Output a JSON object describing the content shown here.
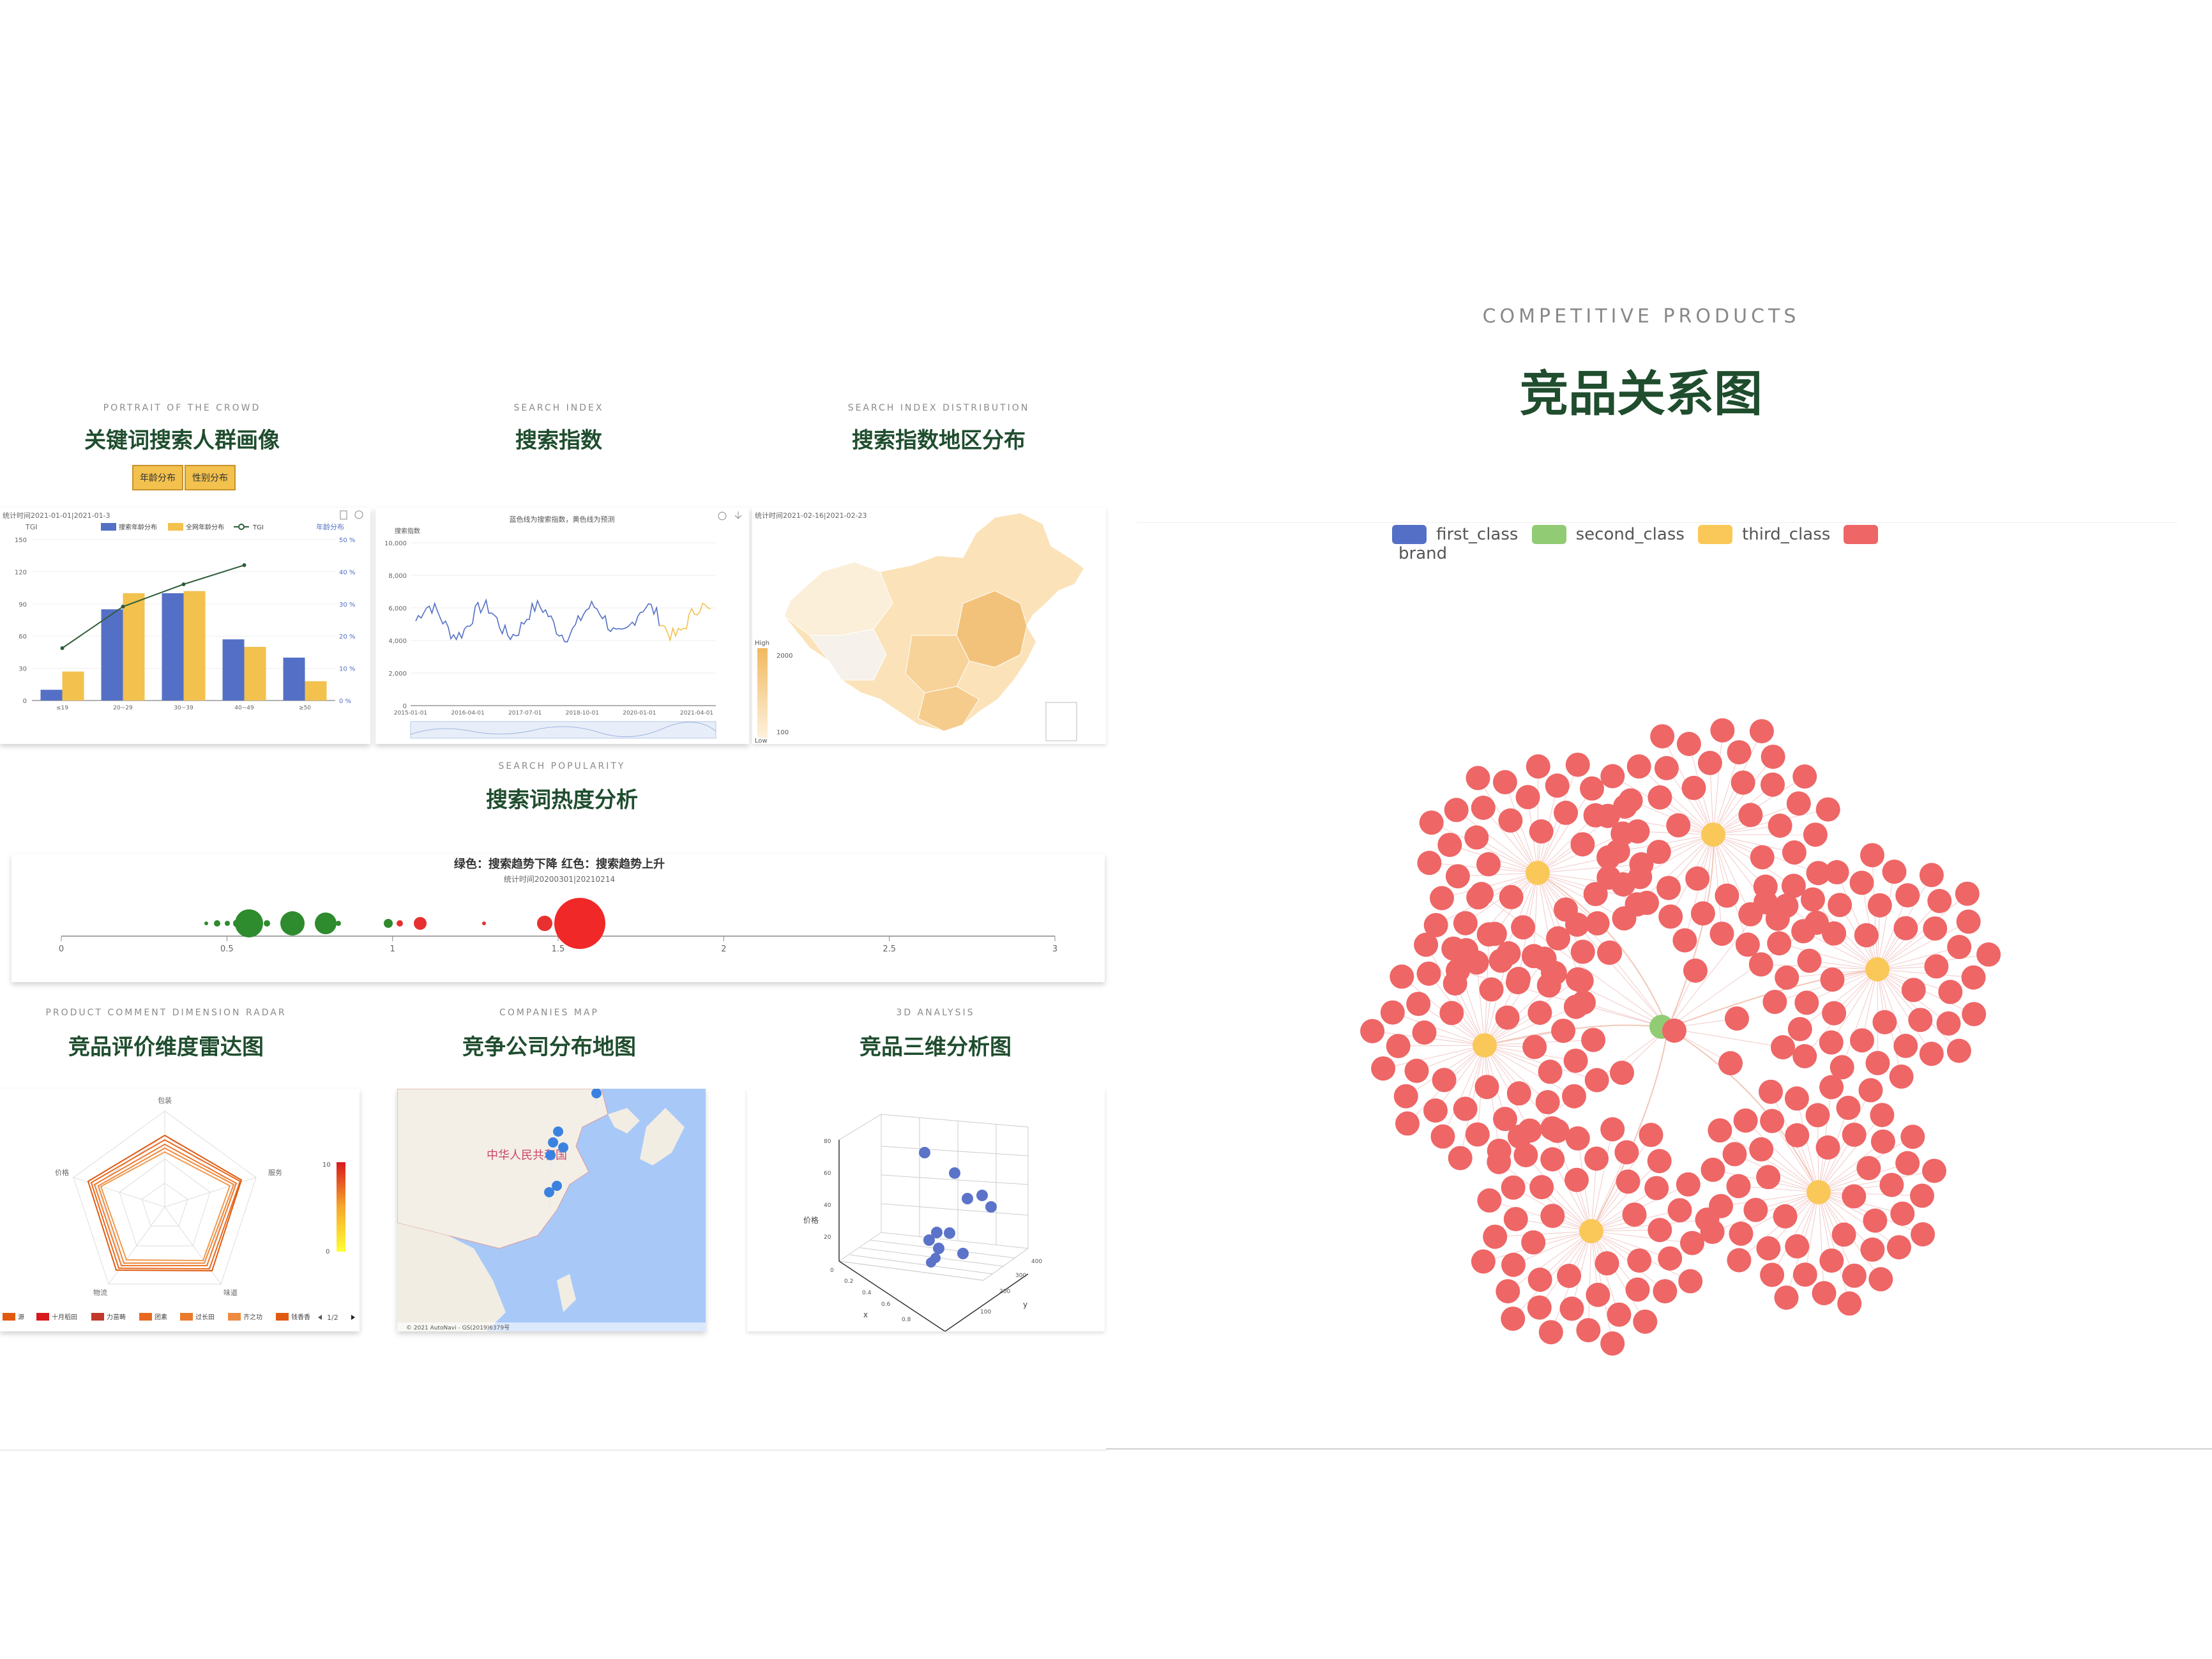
{
  "left": {
    "portrait": {
      "en": "PORTRAIT OF THE CROWD",
      "cn": "关键词搜索人群画像",
      "btn_age": "年龄分布",
      "btn_gender": "性别分布",
      "card_note": "统计时间2021-01-01|2021-01-3",
      "axis_left": "TGI",
      "axis_right": "年龄分布",
      "legend": [
        "搜索年龄分布",
        "全网年龄分布",
        "TGI"
      ]
    },
    "search_index": {
      "en": "SEARCH INDEX",
      "cn": "搜索指数",
      "card_note": "蓝色线为搜索指数，黄色线为预测",
      "axis_title": "搜索指数"
    },
    "search_dist": {
      "en": "SEARCH INDEX DISTRIBUTION",
      "cn": "搜索指数地区分布",
      "card_note": "统计时间2021-02-16|2021-02-23",
      "high": "High",
      "low": "Low",
      "max": "2000",
      "min": "100"
    },
    "popularity": {
      "en": "SEARCH POPULARITY",
      "cn": "搜索词热度分析",
      "title": "绿色：搜索趋势下降  红色：搜索趋势上升",
      "subtitle": "统计时间20200301|20210214",
      "ticks": [
        "0",
        "0.5",
        "1",
        "1.5",
        "2",
        "2.5",
        "3"
      ]
    },
    "radar": {
      "en": "PRODUCT COMMENT DIMENSION RADAR",
      "cn": "竞品评价维度雷达图",
      "scale_max": "10",
      "scale_min": "0",
      "axes": [
        "包装",
        "服务",
        "味道",
        "物流",
        "价格"
      ],
      "legend": [
        "源",
        "十月稻田",
        "力苗畴",
        "团素",
        "过长田",
        "齐之功",
        "钱香香"
      ],
      "pager": "1/2"
    },
    "companies": {
      "en": "COMPANIES MAP",
      "cn": "竞争公司分布地图",
      "country": "中华人民共和国",
      "footer": "© 2021 AutoNavi - GS(2019)6379号"
    },
    "analysis3d": {
      "en": "3D ANALYSIS",
      "cn": "竞品三维分析图",
      "zlabel": "价格",
      "xlabel": "x",
      "ylabel": "y",
      "z_ticks": [
        "80",
        "60",
        "40",
        "20",
        "0"
      ],
      "x_ticks": [
        "0.2",
        "0.4",
        "0.6",
        "0.8"
      ],
      "y_ticks": [
        "100",
        "200",
        "300",
        "400"
      ]
    }
  },
  "right": {
    "en": "COMPETITIVE PRODUCTS",
    "cn": "竞品关系图",
    "legend": [
      {
        "label": "first_class",
        "color": "#5470c6"
      },
      {
        "label": "second_class",
        "color": "#91cc75"
      },
      {
        "label": "third_class",
        "color": "#fac858"
      },
      {
        "label": "brand",
        "color": "#ee6666"
      }
    ]
  },
  "colors": {
    "blue": "#5470c6",
    "yellow": "#f2c14e",
    "green": "#2e8b2e",
    "red": "#e83030",
    "title_green": "#1f4d2e"
  },
  "chart_data": [
    {
      "type": "bar",
      "categories": [
        "≤19",
        "20~29",
        "30~39",
        "40~49",
        "≥50"
      ],
      "series": [
        {
          "name": "搜索年龄分布",
          "values": [
            10,
            85,
            100,
            57,
            40
          ]
        },
        {
          "name": "全网年龄分布",
          "values": [
            27,
            100,
            102,
            50,
            18
          ]
        }
      ],
      "ylim": [
        0,
        150
      ],
      "yticks": [
        "0",
        "30",
        "60",
        "90",
        "120",
        "150"
      ],
      "y2ticks": [
        "0 %",
        "10 %",
        "20 %",
        "30 %",
        "40 %",
        "50 %"
      ]
    },
    {
      "type": "line",
      "xticks": [
        "2015-01-01",
        "2016-04-01",
        "2017-07-01",
        "2018-10-01",
        "2020-01-01",
        "2021-04-01"
      ],
      "yticks": [
        "0",
        "2,000",
        "4,000",
        "6,000",
        "8,000",
        "10,000"
      ],
      "ylim": [
        0,
        10000
      ]
    }
  ]
}
